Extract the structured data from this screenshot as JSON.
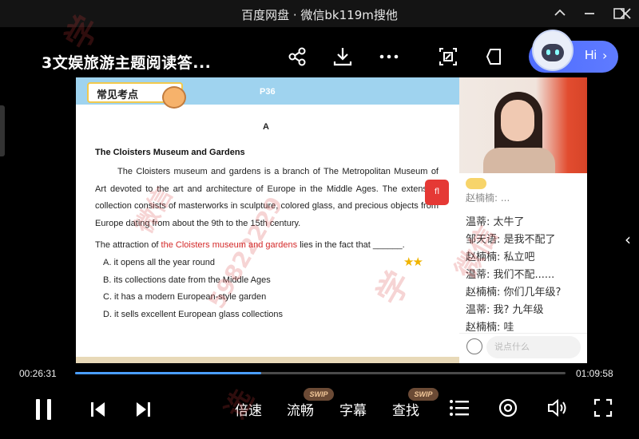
{
  "window": {
    "title": "百度网盘 · 微信bk119m搜他",
    "minimize_icon": "pin-icon",
    "controls": [
      "minimize-icon",
      "maximize-icon",
      "close-icon"
    ]
  },
  "header": {
    "video_title": "3文娱旅游主题阅读答...",
    "actions": [
      "share-icon",
      "download-icon",
      "more-icon",
      "pip-icon",
      "tag-icon"
    ],
    "assistant_label": "Hi"
  },
  "slide": {
    "tag_label": "常见考点",
    "page": "P36",
    "section": "A",
    "passage_title": "The Cloisters Museum and Gardens",
    "passage": "The Cloisters museum and gardens is a branch of The Metropolitan Museum of Art devoted to the art and architecture of Europe in the Middle Ages. The extensive collection consists of masterworks in sculpture, colored glass, and precious objects from Europe dating from about the 9th to the 15th century.",
    "question_prefix": "The attraction of ",
    "question_highlight": "the Cloisters museum and gardens",
    "question_suffix": " lies in the fact that ______.",
    "options": [
      "A. it opens all the year round",
      "B. its collections date from the Middle Ages",
      "C. it has a modern European-style garden",
      "D. it sells excellent European glass collections"
    ],
    "stars": "★★",
    "red_tag": "fl"
  },
  "chat": {
    "partial_top": "赵楠楠: ...",
    "messages": [
      "温蒂: 太牛了",
      "邹天语: 是我不配了",
      "赵楠楠: 私立吧",
      "温蒂: 我们不配......",
      "赵楠楠: 你们几年级?",
      "温蒂: 我? 九年级",
      "赵楠楠: 哇"
    ],
    "input_placeholder": "说点什么"
  },
  "player": {
    "current_time": "00:26:31",
    "total_time": "01:09:58",
    "progress": 0.379,
    "speed_label": "倍速",
    "quality_label": "流畅",
    "subtitle_label": "字幕",
    "search_label": "查找",
    "swip_badge": "SWIP",
    "accent_color": "#4a9eff"
  },
  "watermarks": [
    "学",
    "微信",
    "59822229",
    "学",
    "微信",
    "选"
  ]
}
